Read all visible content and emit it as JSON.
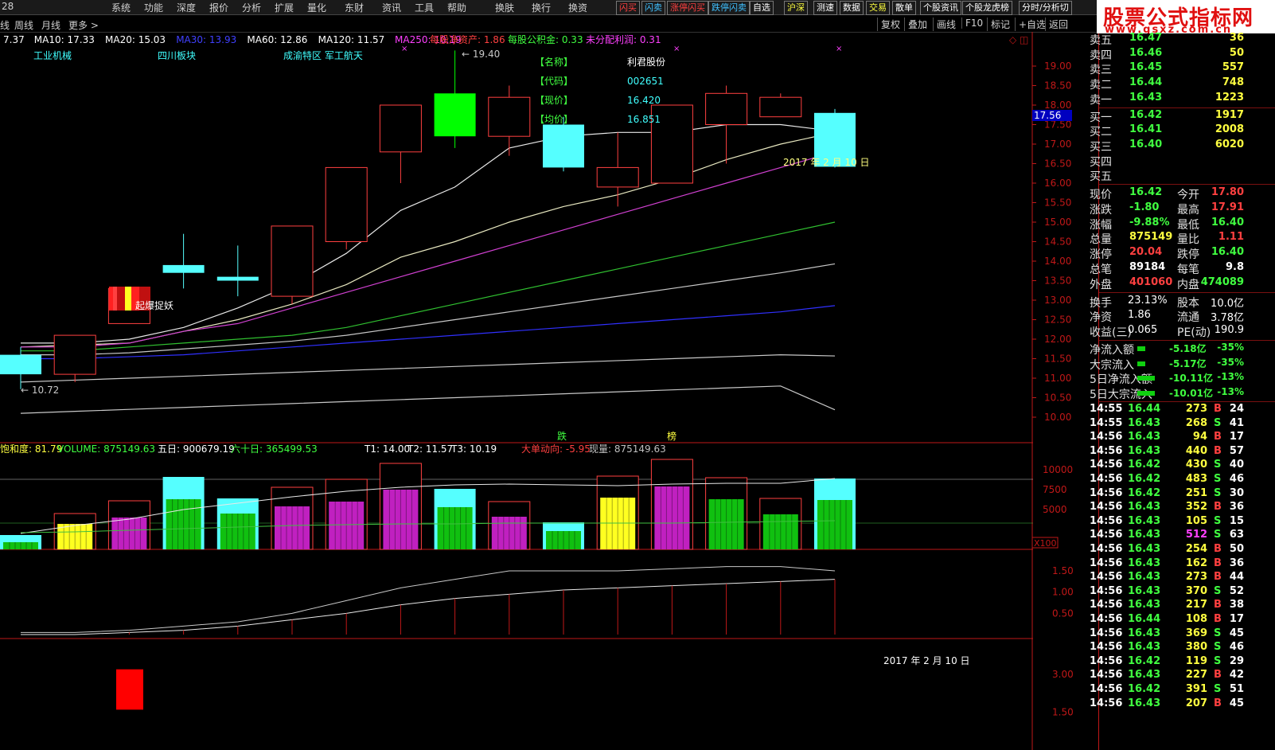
{
  "menu": {
    "code": "28",
    "items": [
      "系统",
      "功能",
      "深度",
      "报价",
      "分析",
      "扩展",
      "量化",
      "东财",
      "资讯",
      "工具",
      "帮助",
      "换肤",
      "换行",
      "换资"
    ],
    "quick_buttons": [
      {
        "label": "闪买",
        "color": "#ff4040"
      },
      {
        "label": "闪卖",
        "color": "#40c0ff"
      },
      {
        "label": "涨停闪买",
        "color": "#ff4040"
      },
      {
        "label": "跌停闪卖",
        "color": "#40c0ff"
      },
      {
        "label": "自选",
        "color": "#ffffff"
      },
      {
        "label": "沪深",
        "color": "#ffff40"
      },
      {
        "label": "测速",
        "color": "#ffffff"
      },
      {
        "label": "数据",
        "color": "#ffffff"
      },
      {
        "label": "交易",
        "color": "#ffff40"
      },
      {
        "label": "散单",
        "color": "#ffffff"
      },
      {
        "label": "个股资讯",
        "color": "#ffffff"
      },
      {
        "label": "个股龙虎榜",
        "color": "#ffffff"
      },
      {
        "label": "分时/分析切",
        "color": "#ffffff"
      }
    ]
  },
  "toolbar": {
    "periods": [
      "线",
      "周线",
      "月线",
      "更多 >"
    ],
    "right_buttons": [
      "复权",
      "叠加",
      "画线",
      "F10",
      "标记",
      "+自选",
      "返回"
    ]
  },
  "logo": {
    "line1": "股票公式指标网",
    "line2": "www.gsxz.com.cn"
  },
  "ma_legend": [
    {
      "text": "7.37",
      "color": "#ffffff"
    },
    {
      "text": "MA10: 17.33",
      "color": "#ffffff"
    },
    {
      "text": "MA20: 15.03",
      "color": "#ffffff"
    },
    {
      "text": "MA30: 13.93",
      "color": "#4040ff"
    },
    {
      "text": "MA60: 12.86",
      "color": "#ffffff"
    },
    {
      "text": "MA120: 11.57",
      "color": "#ffffff"
    },
    {
      "text": "MA250: 10.19",
      "color": "#ff40ff"
    }
  ],
  "fin_legend": [
    {
      "text": "每股净资产: 1.86",
      "color": "#ff4040"
    },
    {
      "text": "每股公积金: 0.33",
      "color": "#40ff40"
    },
    {
      "text": "未分配利润: 0.31",
      "color": "#ff40ff"
    }
  ],
  "tags": [
    "工业机械",
    "四川板块",
    "成渝特区 军工航天"
  ],
  "info_box": {
    "labels": [
      "【名称】",
      "【代码】",
      "【现价】",
      "【均价】"
    ],
    "values": [
      "利君股份",
      "002651",
      "16.420",
      "16.851"
    ]
  },
  "annotations": {
    "high": "19.40",
    "low": "10.72",
    "signal": "起爆捉妖",
    "date_main": "2017 年 2 月 10 日",
    "date_bottom": "2017 年 2 月 10 日",
    "die": "跌",
    "bang": "榜",
    "cur_price_tag": "17.56",
    "x100": "X100"
  },
  "vol_legend": [
    {
      "text": "饱和度: 81.79",
      "color": "#ffff40"
    },
    {
      "text": "VOLUME: 875149.63",
      "color": "#40ff40"
    },
    {
      "text": "五日: 900679.19",
      "color": "#ffffff"
    },
    {
      "text": "六十日: 365499.53",
      "color": "#40ff40"
    },
    {
      "text": "T1: 14.00",
      "color": "#ffffff"
    },
    {
      "text": "T2: 11.57",
      "color": "#ffffff"
    },
    {
      "text": "T3: 10.19",
      "color": "#ffffff"
    },
    {
      "text": "大单动向: -5.95",
      "color": "#ff4040"
    },
    {
      "text": "现量: 875149.63",
      "color": "#c0c0c0"
    }
  ],
  "axis": {
    "price": [
      "19.00",
      "18.50",
      "18.00",
      "17.50",
      "17.00",
      "16.50",
      "16.00",
      "15.50",
      "15.00",
      "14.50",
      "14.00",
      "13.50",
      "13.00",
      "12.50",
      "12.00",
      "11.50",
      "11.00",
      "10.50",
      "10.00"
    ],
    "volume": [
      "10000",
      "7500",
      "5000"
    ],
    "ind": [
      "1.50",
      "1.00",
      "0.50"
    ],
    "ind2": [
      "3.00",
      "1.50"
    ]
  },
  "chart_data": {
    "type": "candlestick",
    "candles": [
      {
        "o": 11.6,
        "h": 11.8,
        "l": 10.72,
        "c": 11.1,
        "color": "cyan"
      },
      {
        "o": 11.1,
        "h": 12.1,
        "l": 10.9,
        "c": 12.1,
        "color": "red"
      },
      {
        "o": 12.4,
        "h": 13.3,
        "l": 12.4,
        "c": 13.3,
        "color": "red"
      },
      {
        "o": 13.7,
        "h": 14.7,
        "l": 13.3,
        "c": 13.9,
        "color": "cyan"
      },
      {
        "o": 13.5,
        "h": 14.4,
        "l": 13.1,
        "c": 13.6,
        "color": "cyan"
      },
      {
        "o": 13.1,
        "h": 14.9,
        "l": 12.9,
        "c": 14.9,
        "color": "red"
      },
      {
        "o": 14.5,
        "h": 16.4,
        "l": 14.3,
        "c": 16.4,
        "color": "red"
      },
      {
        "o": 16.8,
        "h": 18.0,
        "l": 16.0,
        "c": 18.0,
        "color": "red"
      },
      {
        "o": 18.3,
        "h": 19.4,
        "l": 16.9,
        "c": 17.2,
        "color": "green"
      },
      {
        "o": 17.2,
        "h": 18.5,
        "l": 16.7,
        "c": 18.2,
        "color": "red"
      },
      {
        "o": 17.5,
        "h": 17.7,
        "l": 16.3,
        "c": 16.4,
        "color": "cyan"
      },
      {
        "o": 15.9,
        "h": 17.3,
        "l": 15.4,
        "c": 16.4,
        "color": "red"
      },
      {
        "o": 16.0,
        "h": 18.0,
        "l": 16.0,
        "c": 18.0,
        "color": "red"
      },
      {
        "o": 17.5,
        "h": 18.5,
        "l": 16.5,
        "c": 18.3,
        "color": "red"
      },
      {
        "o": 17.7,
        "h": 18.3,
        "l": 17.7,
        "c": 18.2,
        "color": "red"
      },
      {
        "o": 17.8,
        "h": 17.9,
        "l": 16.4,
        "c": 16.42,
        "color": "cyan"
      }
    ],
    "ma_lines": [
      {
        "name": "MA10",
        "color": "#e8e8e8",
        "values": [
          11.9,
          11.9,
          12.0,
          12.3,
          12.8,
          13.4,
          14.2,
          15.3,
          15.9,
          16.9,
          17.2,
          17.3,
          17.3,
          17.5,
          17.5,
          17.33
        ]
      },
      {
        "name": "MA20",
        "color": "#e8e8c0",
        "values": [
          11.8,
          11.85,
          11.9,
          12.2,
          12.5,
          12.9,
          13.4,
          14.1,
          14.5,
          15.0,
          15.4,
          15.7,
          16.1,
          16.6,
          17.0,
          17.3
        ]
      },
      {
        "name": "MA30",
        "color": "#d040d0",
        "values": [
          11.8,
          11.8,
          11.9,
          12.2,
          12.4,
          12.8,
          13.2,
          13.6,
          14.0,
          14.4,
          14.8,
          15.2,
          15.6,
          16.0,
          16.4,
          16.8
        ]
      },
      {
        "name": "MA60",
        "color": "#30c030",
        "values": [
          11.7,
          11.7,
          11.8,
          11.9,
          12.0,
          12.1,
          12.3,
          12.6,
          12.9,
          13.2,
          13.5,
          13.8,
          14.1,
          14.4,
          14.7,
          15.0
        ]
      },
      {
        "name": "MA120",
        "color": "#c8c8c8",
        "values": [
          11.6,
          11.6,
          11.65,
          11.75,
          11.85,
          11.95,
          12.1,
          12.3,
          12.5,
          12.7,
          12.9,
          13.1,
          13.3,
          13.5,
          13.7,
          13.93
        ]
      },
      {
        "name": "MA250",
        "color": "#3030ff",
        "values": [
          11.5,
          11.5,
          11.55,
          11.6,
          11.7,
          11.8,
          11.9,
          12.0,
          12.1,
          12.2,
          12.3,
          12.4,
          12.5,
          12.6,
          12.7,
          12.86
        ]
      },
      {
        "name": "T2",
        "color": "#c8c8c8",
        "values": [
          10.9,
          10.95,
          11.0,
          11.05,
          11.1,
          11.15,
          11.2,
          11.25,
          11.3,
          11.35,
          11.4,
          11.45,
          11.5,
          11.55,
          11.6,
          11.57
        ]
      },
      {
        "name": "T3",
        "color": "#c8c8c8",
        "values": [
          10.1,
          10.15,
          10.2,
          10.25,
          10.3,
          10.35,
          10.4,
          10.45,
          10.5,
          10.55,
          10.6,
          10.65,
          10.7,
          10.75,
          10.8,
          10.19
        ]
      }
    ],
    "volume_bars": [
      {
        "total": 1800,
        "inner": 900,
        "color": "cyan",
        "inner_color": "green"
      },
      {
        "total": 4500,
        "inner": 3200,
        "color": "red",
        "inner_color": "yellow"
      },
      {
        "total": 6100,
        "inner": 4000,
        "color": "red",
        "inner_color": "purple"
      },
      {
        "total": 9100,
        "inner": 6300,
        "color": "cyan",
        "inner_color": "green"
      },
      {
        "total": 6400,
        "inner": 4500,
        "color": "cyan",
        "inner_color": "green"
      },
      {
        "total": 7800,
        "inner": 5400,
        "color": "red",
        "inner_color": "purple"
      },
      {
        "total": 8800,
        "inner": 6000,
        "color": "red",
        "inner_color": "purple"
      },
      {
        "total": 10800,
        "inner": 7500,
        "color": "red",
        "inner_color": "purple"
      },
      {
        "total": 7600,
        "inner": 5300,
        "color": "cyan",
        "inner_color": "green"
      },
      {
        "total": 6000,
        "inner": 4100,
        "color": "red",
        "inner_color": "purple"
      },
      {
        "total": 3400,
        "inner": 2300,
        "color": "cyan",
        "inner_color": "green"
      },
      {
        "total": 9200,
        "inner": 6500,
        "color": "red",
        "inner_color": "yellow"
      },
      {
        "total": 11300,
        "inner": 7900,
        "color": "red",
        "inner_color": "purple"
      },
      {
        "total": 9000,
        "inner": 6300,
        "color": "red",
        "inner_color": "green"
      },
      {
        "total": 6400,
        "inner": 4400,
        "color": "red",
        "inner_color": "green"
      },
      {
        "total": 8900,
        "inner": 6200,
        "color": "cyan",
        "inner_color": "green"
      }
    ],
    "vol_ma": [
      2000,
      3000,
      3800,
      5000,
      5800,
      6600,
      7300,
      7800,
      8100,
      8200,
      8100,
      8000,
      8200,
      8300,
      8300,
      8900
    ],
    "vol_ma60": [
      2100,
      2200,
      2400,
      2600,
      2800,
      3000,
      3100,
      3200,
      3200,
      3300,
      3300,
      3300,
      3300,
      3400,
      3500,
      3600
    ],
    "ind1": [
      0.05,
      0.05,
      0.1,
      0.2,
      0.3,
      0.5,
      0.8,
      1.1,
      1.3,
      1.5,
      1.5,
      1.5,
      1.55,
      1.6,
      1.6,
      1.5
    ],
    "ind1b": [
      0.0,
      0.0,
      0.05,
      0.1,
      0.2,
      0.35,
      0.5,
      0.7,
      0.85,
      0.95,
      1.05,
      1.1,
      1.15,
      1.2,
      1.25,
      1.3
    ],
    "ind2_bar": {
      "index": 2,
      "value": 3.2
    }
  },
  "panel": {
    "sell": [
      {
        "label": "卖五",
        "price": "16.47",
        "vol": "36"
      },
      {
        "label": "卖四",
        "price": "16.46",
        "vol": "50"
      },
      {
        "label": "卖三",
        "price": "16.45",
        "vol": "557"
      },
      {
        "label": "卖二",
        "price": "16.44",
        "vol": "748"
      },
      {
        "label": "卖一",
        "price": "16.43",
        "vol": "1223"
      }
    ],
    "buy": [
      {
        "label": "买一",
        "price": "16.42",
        "vol": "1917"
      },
      {
        "label": "买二",
        "price": "16.41",
        "vol": "2008"
      },
      {
        "label": "买三",
        "price": "16.40",
        "vol": "6020"
      },
      {
        "label": "买四",
        "price": "",
        "vol": ""
      },
      {
        "label": "买五",
        "price": "",
        "vol": ""
      }
    ],
    "stats": [
      {
        "l1": "现价",
        "v1": "16.42",
        "c1": "#40ff40",
        "l2": "今开",
        "v2": "17.80",
        "c2": "#ff4040"
      },
      {
        "l1": "涨跌",
        "v1": "-1.80",
        "c1": "#40ff40",
        "l2": "最高",
        "v2": "17.91",
        "c2": "#ff4040"
      },
      {
        "l1": "涨幅",
        "v1": "-9.88%",
        "c1": "#40ff40",
        "l2": "最低",
        "v2": "16.40",
        "c2": "#40ff40"
      },
      {
        "l1": "总量",
        "v1": "875149",
        "c1": "#ffff40",
        "l2": "量比",
        "v2": "1.11",
        "c2": "#ff4040"
      },
      {
        "l1": "涨停",
        "v1": "20.04",
        "c1": "#ff4040",
        "l2": "跌停",
        "v2": "16.40",
        "c2": "#40ff40"
      },
      {
        "l1": "总笔",
        "v1": "89184",
        "c1": "#ffffff",
        "l2": "每笔",
        "v2": "9.8",
        "c2": "#ffffff"
      },
      {
        "l1": "外盘",
        "v1": "401060",
        "c1": "#ff4040",
        "l2": "内盘",
        "v2": "474089",
        "c2": "#40ff40"
      }
    ],
    "stats2": [
      {
        "l1": "换手",
        "v1": "23.13%",
        "l2": "股本",
        "v2": "10.0亿"
      },
      {
        "l1": "净资",
        "v1": "1.86",
        "l2": "流通",
        "v2": "3.78亿"
      },
      {
        "l1": "收益(三)",
        "v1": "0.065",
        "l2": "PE(动)",
        "v2": "190.9"
      }
    ],
    "flows": [
      {
        "label": "净流入额",
        "val": "-5.18亿",
        "pct": "-35%",
        "bar": 10
      },
      {
        "label": "大宗流入",
        "val": "-5.17亿",
        "pct": "-35%",
        "bar": 10
      },
      {
        "label": "5日净流入额",
        "val": "-10.11亿",
        "pct": "-13%",
        "bar": 22
      },
      {
        "label": "5日大宗流入",
        "val": "-10.01亿",
        "pct": "-13%",
        "bar": 22
      }
    ],
    "ticks": [
      {
        "t": "14:55",
        "p": "16.44",
        "v": "273",
        "s": "B",
        "n": "24"
      },
      {
        "t": "14:55",
        "p": "16.43",
        "v": "268",
        "s": "S",
        "n": "41"
      },
      {
        "t": "14:56",
        "p": "16.43",
        "v": "94",
        "s": "B",
        "n": "17"
      },
      {
        "t": "14:56",
        "p": "16.43",
        "v": "440",
        "s": "B",
        "n": "57"
      },
      {
        "t": "14:56",
        "p": "16.42",
        "v": "430",
        "s": "S",
        "n": "40"
      },
      {
        "t": "14:56",
        "p": "16.42",
        "v": "483",
        "s": "S",
        "n": "46"
      },
      {
        "t": "14:56",
        "p": "16.42",
        "v": "251",
        "s": "S",
        "n": "30"
      },
      {
        "t": "14:56",
        "p": "16.43",
        "v": "352",
        "s": "B",
        "n": "36"
      },
      {
        "t": "14:56",
        "p": "16.43",
        "v": "105",
        "s": "S",
        "n": "15"
      },
      {
        "t": "14:56",
        "p": "16.43",
        "v": "512",
        "s": "S",
        "n": "63"
      },
      {
        "t": "14:56",
        "p": "16.43",
        "v": "254",
        "s": "B",
        "n": "50"
      },
      {
        "t": "14:56",
        "p": "16.43",
        "v": "162",
        "s": "B",
        "n": "36"
      },
      {
        "t": "14:56",
        "p": "16.43",
        "v": "273",
        "s": "B",
        "n": "44"
      },
      {
        "t": "14:56",
        "p": "16.43",
        "v": "370",
        "s": "S",
        "n": "52"
      },
      {
        "t": "14:56",
        "p": "16.43",
        "v": "217",
        "s": "B",
        "n": "38"
      },
      {
        "t": "14:56",
        "p": "16.44",
        "v": "108",
        "s": "B",
        "n": "17"
      },
      {
        "t": "14:56",
        "p": "16.43",
        "v": "369",
        "s": "S",
        "n": "45"
      },
      {
        "t": "14:56",
        "p": "16.43",
        "v": "380",
        "s": "S",
        "n": "46"
      },
      {
        "t": "14:56",
        "p": "16.42",
        "v": "119",
        "s": "S",
        "n": "29"
      },
      {
        "t": "14:56",
        "p": "16.43",
        "v": "227",
        "s": "B",
        "n": "42"
      },
      {
        "t": "14:56",
        "p": "16.42",
        "v": "391",
        "s": "S",
        "n": "51"
      },
      {
        "t": "14:56",
        "p": "16.43",
        "v": "207",
        "s": "B",
        "n": "45"
      }
    ]
  }
}
